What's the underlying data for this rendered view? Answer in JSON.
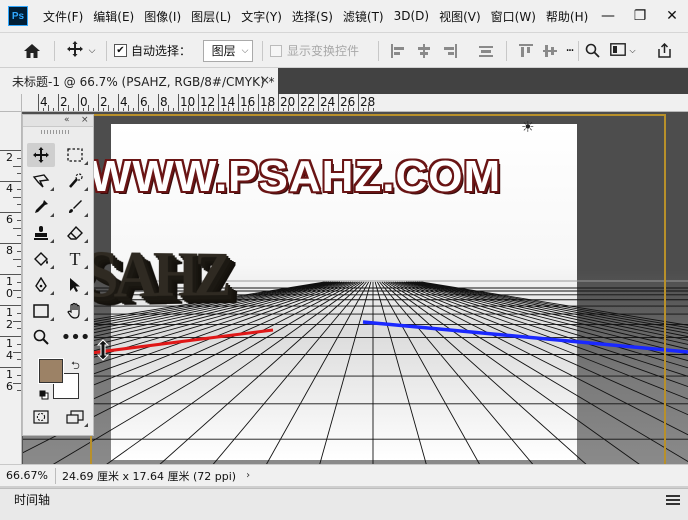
{
  "app": {
    "logo_text": "Ps"
  },
  "menu": [
    "文件(F)",
    "编辑(E)",
    "图像(I)",
    "图层(L)",
    "文字(Y)",
    "选择(S)",
    "滤镜(T)",
    "3D(D)",
    "视图(V)",
    "窗口(W)",
    "帮助(H)"
  ],
  "window_controls": {
    "minimize": "—",
    "restore": "❐",
    "close": "✕"
  },
  "options_bar": {
    "auto_select_label": "自动选择：",
    "auto_select_checked": true,
    "layer_select_value": "图层",
    "show_transform_label": "显示变换控件"
  },
  "document_tab": {
    "title": "未标题-1 @ 66.7% (PSAHZ, RGB/8#/CMYK) *",
    "close": "×"
  },
  "ruler": {
    "top_labels": [
      "4",
      "2",
      "0",
      "2",
      "4",
      "6",
      "8",
      "10",
      "12",
      "14",
      "16",
      "18",
      "20",
      "22",
      "24",
      "26",
      "28"
    ],
    "left_labels": [
      "2",
      "4",
      "6",
      "8",
      "1\n0",
      "1\n2",
      "1\n4",
      "1\n6"
    ]
  },
  "canvas": {
    "headline_text": "WWW.PSAHZ.COM",
    "extruded_text": "PSAHZ",
    "light_icon": "☀"
  },
  "tools": {
    "collapse_glyph": "«",
    "close_glyph": "×",
    "foreground_color": "#9c8266",
    "background_color": "#ffffff"
  },
  "status": {
    "zoom": "66.67%",
    "doc_size": "24.69 厘米 x 17.64 厘米 (72 ppi)",
    "arrow": "›"
  },
  "timeline": {
    "label": "时间轴"
  }
}
